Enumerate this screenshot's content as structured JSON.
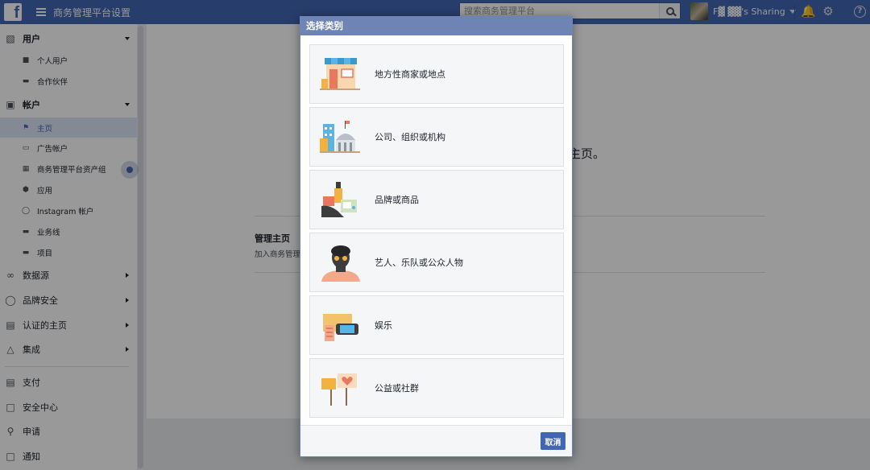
{
  "topbar": {
    "logo": "f",
    "app_title": "商务管理平台设置",
    "search_placeholder": "搜索商务管理平台",
    "account_name": "F▓ ▓▓'s Sharing"
  },
  "sidebar": {
    "users": {
      "label": "用户",
      "items": [
        {
          "label": "个人用户",
          "icon": "person-icon"
        },
        {
          "label": "合作伙伴",
          "icon": "briefcase-icon"
        }
      ]
    },
    "accounts": {
      "label": "帐户",
      "items": [
        {
          "label": "主页",
          "icon": "flag-icon"
        },
        {
          "label": "广告帐户",
          "icon": "ad-icon"
        },
        {
          "label": "商务管理平台资产组",
          "icon": "asset-group-icon"
        },
        {
          "label": "应用",
          "icon": "cube-icon"
        },
        {
          "label": "Instagram 帐户",
          "icon": "instagram-icon"
        },
        {
          "label": "业务线",
          "icon": "layers-icon"
        },
        {
          "label": "项目",
          "icon": "folder-icon"
        }
      ]
    },
    "sections": [
      {
        "label": "数据源",
        "icon": "people-icon"
      },
      {
        "label": "品牌安全",
        "icon": "shield-icon"
      },
      {
        "label": "认证的主页",
        "icon": "clipboard-icon"
      },
      {
        "label": "集成",
        "icon": "network-icon"
      }
    ],
    "bottom": [
      {
        "label": "支付",
        "icon": "card-icon"
      },
      {
        "label": "安全中心",
        "icon": "lock-icon"
      },
      {
        "label": "申请",
        "icon": "key-icon"
      },
      {
        "label": "通知",
        "icon": "notify-icon"
      }
    ]
  },
  "main": {
    "page_fragment": "主页。",
    "manage_title": "管理主页",
    "manage_desc": "加入商务管理"
  },
  "modal": {
    "title": "选择类别",
    "categories": [
      {
        "label": "地方性商家或地点",
        "icon": "storefront-icon"
      },
      {
        "label": "公司、组织或机构",
        "icon": "buildings-icon"
      },
      {
        "label": "品牌或商品",
        "icon": "products-icon"
      },
      {
        "label": "艺人、乐队或公众人物",
        "icon": "person-public-icon"
      },
      {
        "label": "娱乐",
        "icon": "entertainment-icon"
      },
      {
        "label": "公益或社群",
        "icon": "signs-icon"
      }
    ],
    "cancel_label": "取消"
  },
  "colors": {
    "brand_blue": "#4267b2",
    "modal_header": "#6d84b4",
    "active_bg": "#dde6f5"
  }
}
